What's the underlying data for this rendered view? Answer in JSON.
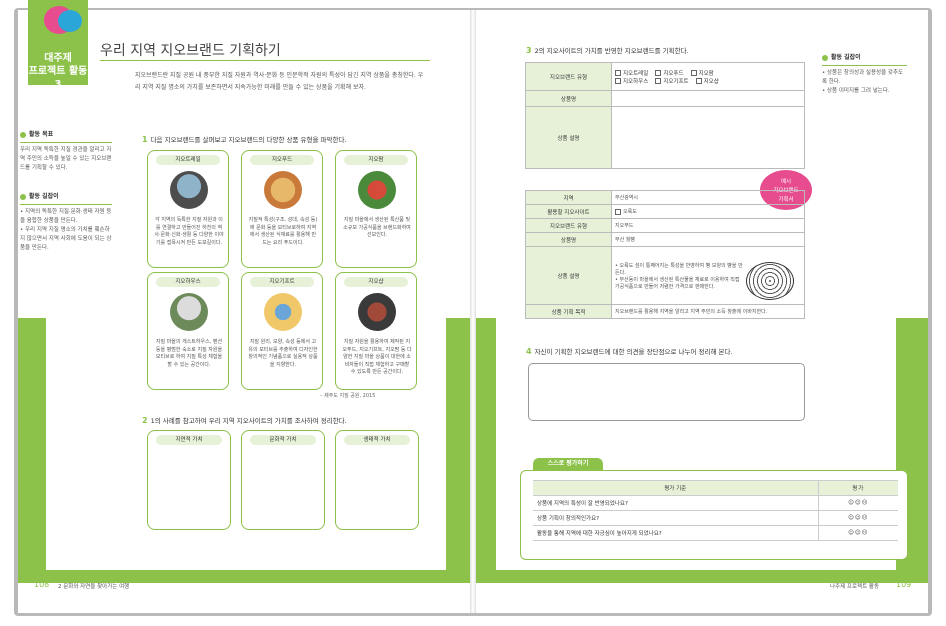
{
  "side": {
    "badge_line1": "대주제",
    "badge_line2": "프로젝트 활동 3"
  },
  "left": {
    "title": "우리 지역 지오브랜드 기획하기",
    "intro": "지오브랜드란 지질 공원 내 풍부한 지질 자원과 역사·문화 등 인문학적 자원의 특성이 담긴 지역 상품을 총칭한다. 우리 지역 지질 명소의 가치를 보존하면서 지속가능한 미래를 만들 수 있는 상품을 기획해 보자.",
    "goal_head": "활동 목표",
    "goal_text": "우리 지역 독특한 지질 경관을 알리고 지역 주민의 소득을 높일 수 있는 지오브랜드를 기획할 수 있다.",
    "guide_head": "활동 길잡이",
    "guide_items": [
      "지역의 독특한 지질·문화·생태 자원 등을 융합한 상품을 만든다.",
      "우리 지역 지질 명소의 가치를 훼손하지 않으면서 지역 사회에 도움이 되는 상품을 만든다."
    ],
    "q1": {
      "num": "1",
      "text": "다음 지오브랜드를 살펴보고 지오브랜드의 다양한 상품 유형을 파악한다."
    },
    "cards": [
      {
        "label": "지오트레일",
        "text": "각 지역의 독특한 지질 자원과 이를 연결하고 만들어진 하천의 역사·문화·신화·생활 등 다양한 이야기를 접목시켜 만든 도보길이다."
      },
      {
        "label": "지오푸드",
        "text": "지질적 특성(구조, 성대, 속성 등)에 문화 등을 모티브로하여 지역에서 생산된 식재료를 활용해 만드는 요리 푸드이다."
      },
      {
        "label": "지오팜",
        "text": "지질 마을에서 생산된 특산품 및 소규모 가공식품을 브랜드화하여 선보인다."
      },
      {
        "label": "지오하우스",
        "text": "지질 마을의 게스트하우스, 펜션 등을 평범한 숙소로 지질 자원을 모티브로 하여 지질 특성 체험을 할 수 있는 공간이다."
      },
      {
        "label": "지오기프트",
        "text": "지질 원리, 모양, 속성 등에서 고유의 모티브를 추출하여 디자인한 창의적인 기념품으로 실용적 상품을 지향한다."
      },
      {
        "label": "지오샵",
        "text": "지질 자원을 활용하여 제작된 지오푸드, 지오기프트, 지오팜 등 다양한 지질 마을 상품이 대한에 소비자들이 직접 체험하고 구매할 수 있도록 만든 공간이다."
      }
    ],
    "source": "– 제주도 지질 공원, 2015",
    "q2": {
      "num": "2",
      "text": "1의 사례를 참고하여 우리 지역 지오사이트의 가치를 조사하여 정리한다."
    },
    "values": [
      "지연적 가치",
      "문화적 가치",
      "생태적 가치"
    ]
  },
  "right": {
    "q3": {
      "num": "3",
      "text": "2의 지오사이트의 가치를 반영한 지오브랜드를 기획한다."
    },
    "form1": {
      "type_label": "지오브랜드 유형",
      "options": [
        "지오트레일",
        "지오푸드",
        "지오팜",
        "지오하우스",
        "지오기프트",
        "지오샵"
      ],
      "name_label": "상품명",
      "desc_label": "상품 설명"
    },
    "badge_line1": "예시",
    "badge_line2": "지오브랜드",
    "badge_line3": "기획서",
    "form2": {
      "region_label": "지역",
      "region_value": "부산광역시",
      "site_label": "활용할 지오사이트",
      "site_value": "오륙도",
      "type_label": "지오브랜드 유형",
      "type_value": "지오푸드",
      "name_label": "상품명",
      "name_value": "부산 월빵",
      "desc_label": "상품 설명",
      "desc_items": [
        "오륙도 섬이 통째어지는 특성을 반영하여 빵 모양의 빵을 만든다.",
        "부산동이 마을에서 생산된 특산물을 재료로 이용하여 직접 가공식품으로 만들어 저렴한 가격으로 판매한다."
      ],
      "purpose_label": "상품 기획 목적",
      "purpose_value": "지오브랜드를 활용해 지역을 알리고 지역 주민의 소득 창출에 이바지한다."
    },
    "q4": {
      "num": "4",
      "text": "자신이 기획한 지오브랜드에 대한 의견을 장단점으로 나누어 정리해 본다."
    },
    "eval": {
      "tab": "스스로 평가하기",
      "head_criteria": "평가 기준",
      "head_score": "평가",
      "rows": [
        "상품에 지역의 특성이 잘 반영되었나요?",
        "상품 기획이 창의적인가요?",
        "활동을 통해 지역에 대한 자긍심이 높아지게 되었나요?"
      ],
      "faces": "☺☺☹"
    },
    "guide_head": "활동 길잡이",
    "guide_items": [
      "상품은 창의성과 실용성을 갖추도록 한다.",
      "상품 이미지를 그려 넣는다."
    ]
  },
  "footer": {
    "left_page": "108",
    "left_label": "2 문화와 자연을 찾아가는 여행",
    "right_label": "나주제 프로젝트 활동",
    "right_page": "109"
  }
}
